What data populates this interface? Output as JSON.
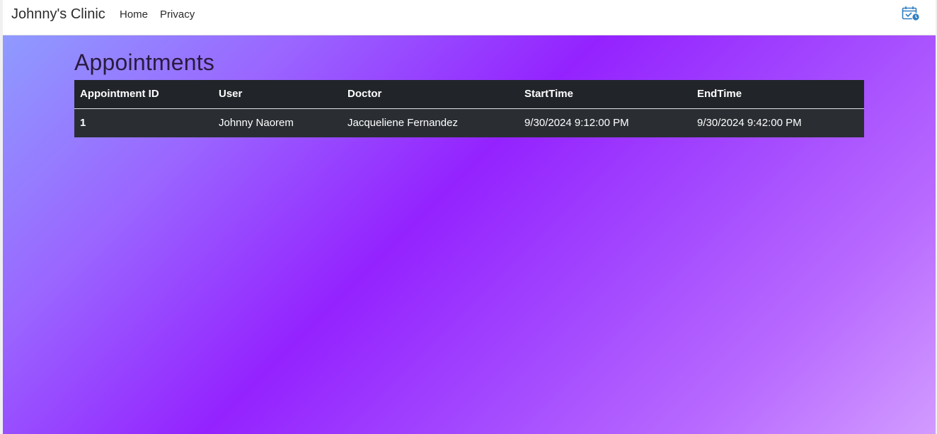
{
  "navbar": {
    "brand": "Johnny's Clinic",
    "links": [
      {
        "label": "Home"
      },
      {
        "label": "Privacy"
      }
    ],
    "calendar_icon": "calendar-clock-icon",
    "calendar_color": "#2f7ec0"
  },
  "main": {
    "title": "Appointments",
    "table": {
      "headers": [
        "Appointment ID",
        "User",
        "Doctor",
        "StartTime",
        "EndTime"
      ],
      "rows": [
        {
          "id": "1",
          "user": "Johnny Naorem",
          "doctor": "Jacqueliene Fernandez",
          "start": "9/30/2024 9:12:00 PM",
          "end": "9/30/2024 9:42:00 PM"
        }
      ]
    }
  },
  "colors": {
    "table_bg": "#212529",
    "gradient_start": "#8f9bff",
    "gradient_mid": "#9422ff",
    "gradient_end": "#d29bff"
  }
}
